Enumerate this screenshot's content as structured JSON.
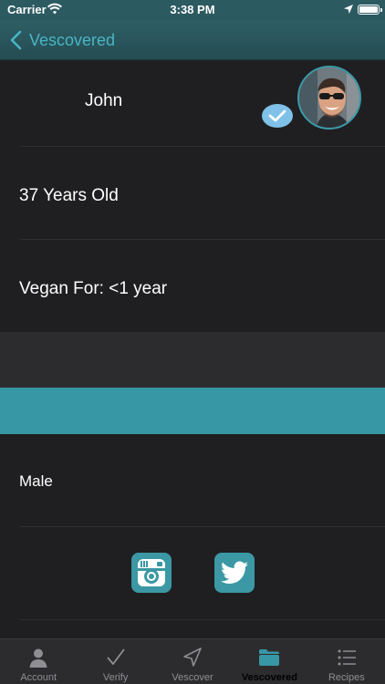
{
  "status_bar": {
    "carrier": "Carrier",
    "time": "3:38 PM"
  },
  "nav": {
    "back_label": "Vescovered"
  },
  "profile": {
    "name": "John",
    "age": "37 Years Old",
    "vegan_for": "Vegan For: <1 year",
    "gender": "Male"
  },
  "colors": {
    "accent": "#3897a4",
    "nav_bg": "#2c5a61",
    "background": "#1f1f21"
  },
  "social": [
    {
      "icon": "instagram-icon"
    },
    {
      "icon": "twitter-icon"
    }
  ],
  "tabs": [
    {
      "label": "Account",
      "icon": "person-icon"
    },
    {
      "label": "Verify",
      "icon": "checkmark-icon"
    },
    {
      "label": "Vescover",
      "icon": "location-arrow-icon"
    },
    {
      "label": "Vescovered",
      "icon": "folder-icon",
      "active": true
    },
    {
      "label": "Recipes",
      "icon": "list-icon"
    }
  ]
}
